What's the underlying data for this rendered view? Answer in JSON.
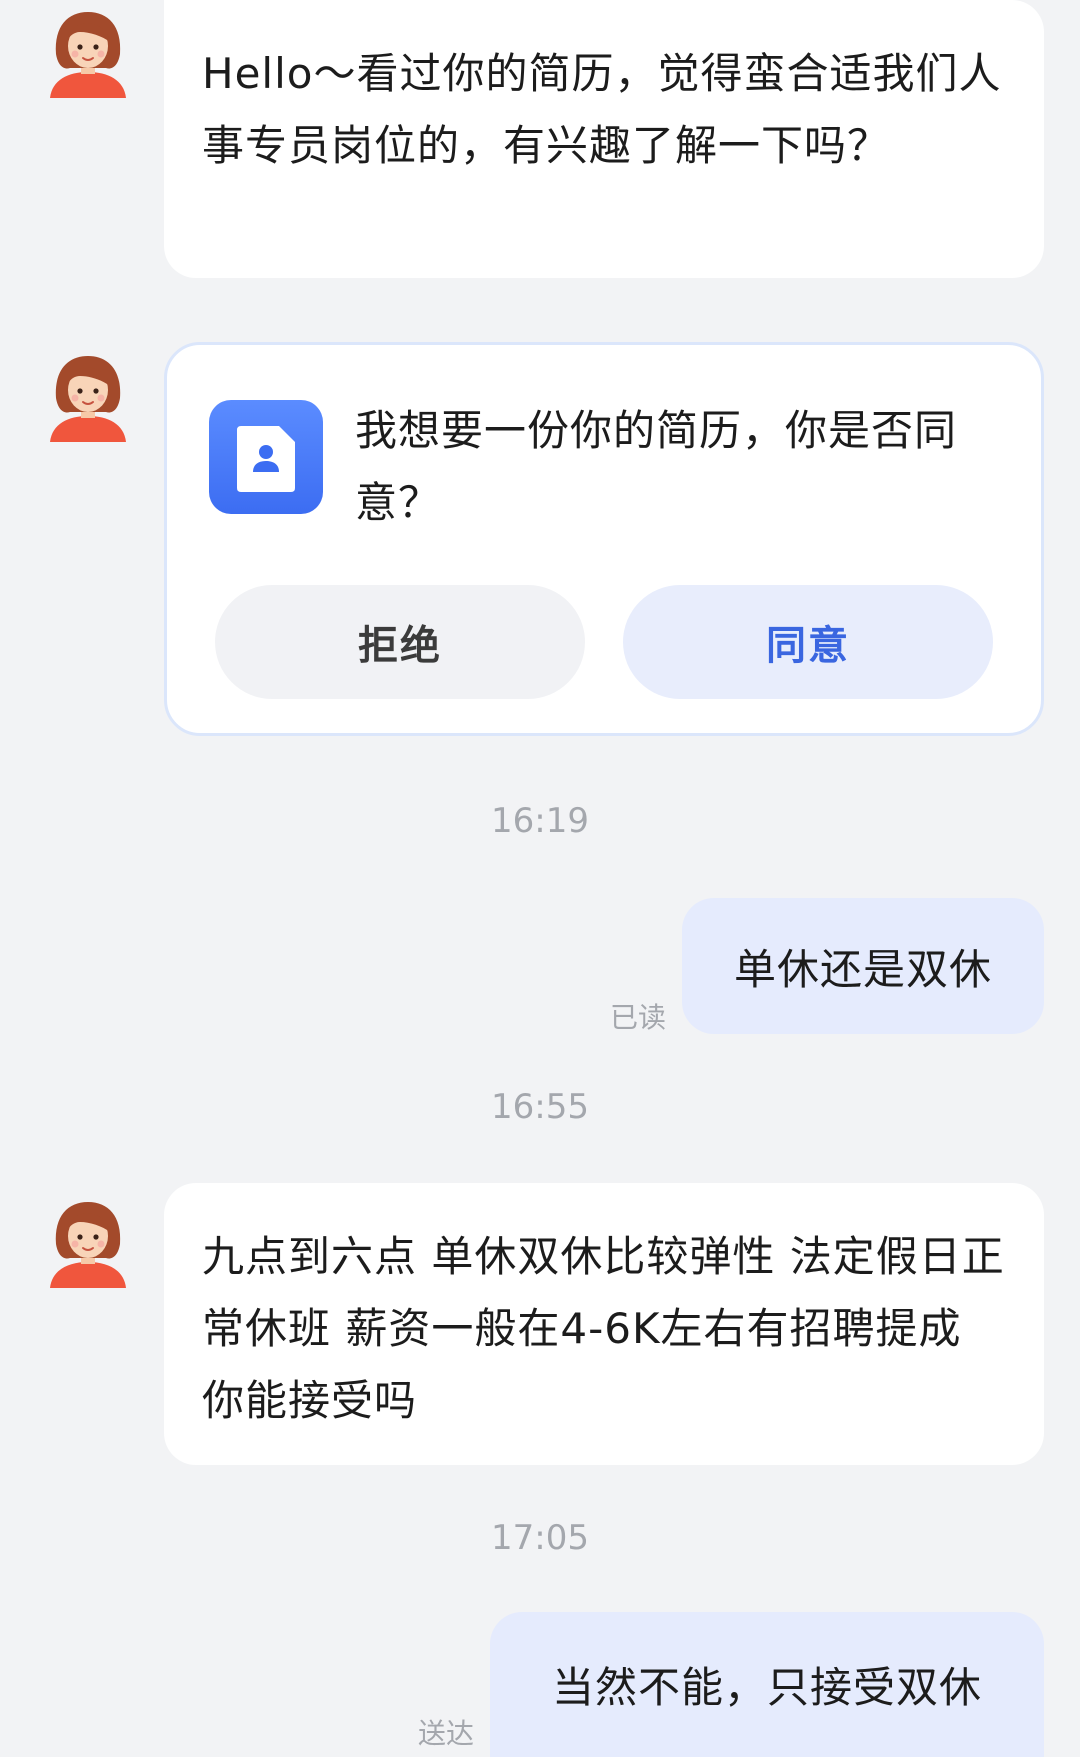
{
  "messages": {
    "m1_text": "Hello～看过你的简历，觉得蛮合适我们人事专员岗位的，有兴趣了解一下吗？",
    "card_text": "我想要一份你的简历，你是否同意？",
    "card_reject": "拒绝",
    "card_agree": "同意",
    "time1": "16:19",
    "out1_text": "单休还是双休",
    "out1_status": "已读",
    "time2": "16:55",
    "m2_text": "九点到六点 单休双休比较弹性 法定假日正常休班 薪资一般在4-6K左右有招聘提成  你能接受吗",
    "time3": "17:05",
    "out2_text": "当然不能，只接受双休",
    "out2_status": "送达"
  },
  "colors": {
    "background": "#f2f3f5",
    "accent": "#3a66e0",
    "outgoing_bubble": "#e5ebfd",
    "icon_gradient_top": "#5b8cff",
    "icon_gradient_bottom": "#3c6df2"
  },
  "icons": {
    "avatar": "girl-avatar-icon",
    "card_icon": "resume-document-icon"
  }
}
